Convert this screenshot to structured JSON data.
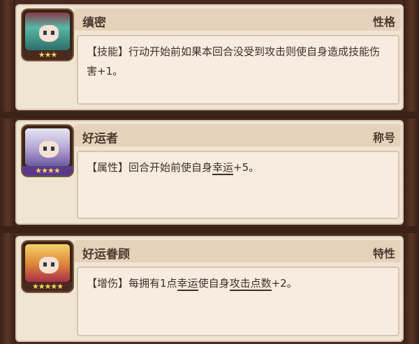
{
  "cards": [
    {
      "name": "缜密",
      "tag": "性格",
      "stars": "★★★",
      "desc_parts": [
        "【技能】行动开始前如果本回合没受到攻击则使自身造成技能伤害+1。"
      ],
      "icon": "character-portrait-green-hair"
    },
    {
      "name": "好运者",
      "tag": "称号",
      "stars": "★★★★",
      "desc_prefix": "【属性】回合开始前使自身",
      "desc_link": "幸运",
      "desc_suffix": "+5。",
      "icon": "character-portrait-white-hair"
    },
    {
      "name": "好运眷顾",
      "tag": "特性",
      "stars": "★★★★★",
      "desc_prefix": "【增伤】每拥有1点",
      "desc_link1": "幸运",
      "desc_mid": "使自身",
      "desc_link2": "攻击点数",
      "desc_suffix": "+2。",
      "icon": "character-portrait-blonde-hair"
    }
  ],
  "colors": {
    "card_bg": "#f0e4d3",
    "header_bg": "#e6d2bb",
    "frame": "#4a2a1e",
    "star": "#f7d45a"
  }
}
